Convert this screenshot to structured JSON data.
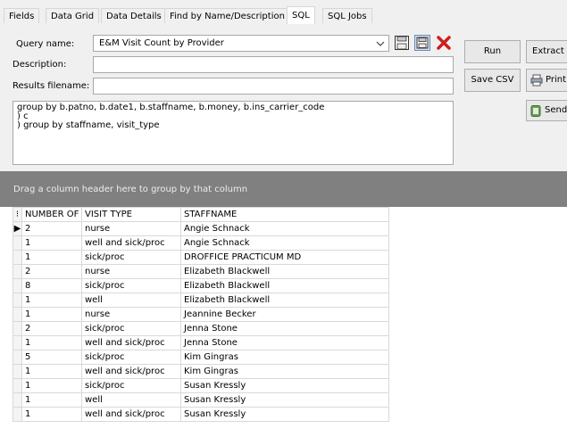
{
  "tabs": [
    {
      "label": "Fields",
      "active": false
    },
    {
      "label": "Data Grid",
      "active": false
    },
    {
      "label": "Data Details",
      "active": false
    },
    {
      "label": "Find by Name/Description",
      "active": false
    },
    {
      "label": "SQL",
      "active": true
    },
    {
      "label": "SQL Jobs",
      "active": false
    }
  ],
  "form": {
    "query_name_label": "Query name:",
    "query_name_value": "E&M Visit Count by Provider",
    "description_label": "Description:",
    "description_value": "",
    "results_filename_label": "Results filename:",
    "results_filename_value": ""
  },
  "buttons": {
    "run": "Run",
    "extract": "Extract",
    "save_csv": "Save CSV",
    "print": "Print",
    "send": "Send"
  },
  "sql_lines": [
    "group by b.patno, b.date1, b.staffname, b.money, b.ins_carrier_code",
    ") c",
    ") group by staffname, visit_type"
  ],
  "group_hint": "Drag a column header here to group by that column",
  "grid": {
    "columns": [
      "NUMBER OF",
      "VISIT TYPE",
      "STAFFNAME"
    ],
    "rows": [
      [
        "2",
        "nurse",
        "Angie Schnack"
      ],
      [
        "1",
        "well and sick/proc",
        "Angie Schnack"
      ],
      [
        "1",
        "sick/proc",
        "DROFFICE PRACTICUM MD"
      ],
      [
        "2",
        "nurse",
        "Elizabeth Blackwell"
      ],
      [
        "8",
        "sick/proc",
        "Elizabeth Blackwell"
      ],
      [
        "1",
        "well",
        "Elizabeth Blackwell"
      ],
      [
        "1",
        "nurse",
        "Jeannine Becker"
      ],
      [
        "2",
        "sick/proc",
        "Jenna Stone"
      ],
      [
        "1",
        "well and sick/proc",
        "Jenna Stone"
      ],
      [
        "5",
        "sick/proc",
        "Kim  Gingras"
      ],
      [
        "1",
        "well and sick/proc",
        "Kim  Gingras"
      ],
      [
        "1",
        "sick/proc",
        "Susan Kressly"
      ],
      [
        "1",
        "well",
        "Susan Kressly"
      ],
      [
        "1",
        "well and sick/proc",
        "Susan Kressly"
      ]
    ]
  },
  "icons": {
    "save": "save-icon",
    "save_as": "save-as-icon",
    "delete": "delete-icon",
    "dropdown": "chevron-down-icon",
    "print": "printer-icon",
    "send": "send-icon",
    "row_pointer": "current-row-arrow-icon",
    "grid_menu": "grid-menu-icon"
  },
  "colors": {
    "panel_bg": "#f0f0f0",
    "group_bar_bg": "#808080",
    "delete_red": "#cc1f1f",
    "grid_border": "#d9d9d9"
  }
}
